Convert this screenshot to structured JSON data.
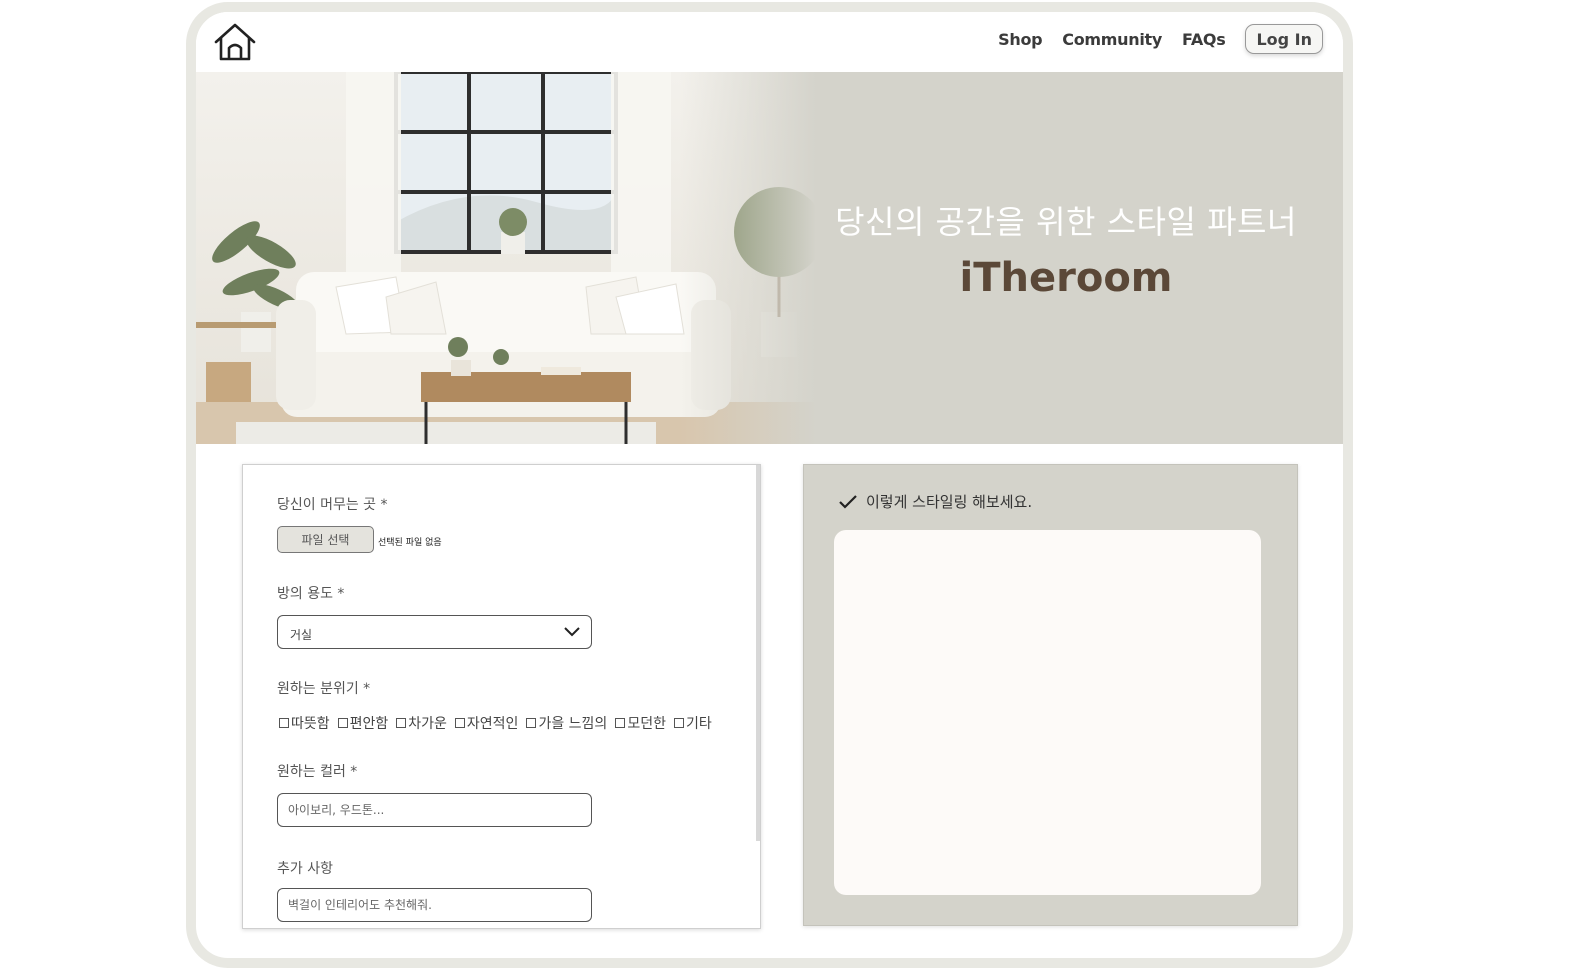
{
  "nav": {
    "items": [
      "Shop",
      "Community",
      "FAQs"
    ],
    "login_label": "Log In"
  },
  "hero": {
    "subtitle": "당신의 공간을 위한 스타일 파트너",
    "title": "iTheroom"
  },
  "form": {
    "location_label": "당신이 머무는 곳 *",
    "file_button": "파일 선택",
    "file_status": "선택된 파일 없음",
    "room_label": "방의 용도 *",
    "room_value": "거실",
    "mood_label": "원하는 분위기 *",
    "moods": [
      "따뜻함",
      "편안함",
      "차가운",
      "자연적인",
      "가을 느낌의",
      "모던한",
      "기타"
    ],
    "color_label": "원하는 컬러 *",
    "color_placeholder": "아이보리, 우드톤...",
    "extra_label": "추가 사항",
    "extra_placeholder": "벽걸이 인테리어도 추천해줘."
  },
  "result": {
    "heading": "이렇게 스타일링 해보세요."
  },
  "colors": {
    "hero_bg": "#d4d3cb",
    "title_brown": "#5b4838",
    "frame_border": "#e8e8e2",
    "result_box": "#fdfaf8"
  },
  "icons": {
    "home": "home-icon",
    "chevron": "chevron-down-icon",
    "check": "checkmark-icon"
  }
}
